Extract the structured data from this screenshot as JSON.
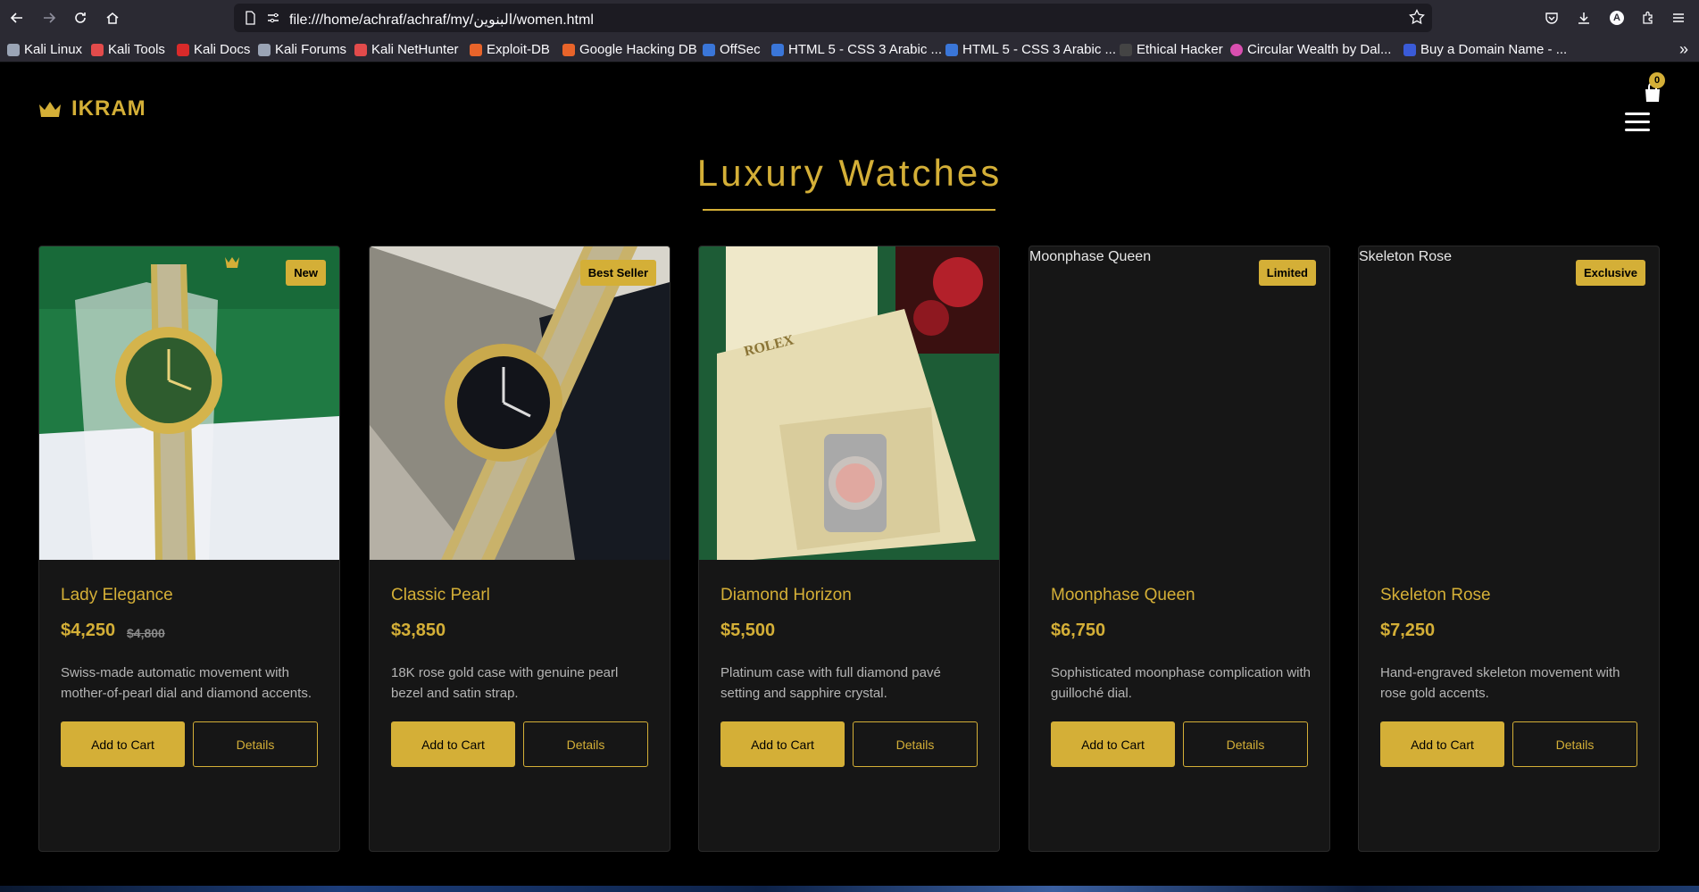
{
  "browser": {
    "url": "file:///home/achraf/achraf/my/البنوين/women.html",
    "avatar_letter": "A"
  },
  "bookmarks": [
    {
      "label": "Kali Linux",
      "icon": "kali-dragon-icon",
      "color": "#9aa4b5"
    },
    {
      "label": "Kali Tools",
      "icon": "kali-tools-icon",
      "color": "#e24b4b"
    },
    {
      "label": "Kali Docs",
      "icon": "kali-docs-icon",
      "color": "#d92a2a"
    },
    {
      "label": "Kali Forums",
      "icon": "kali-dragon-icon",
      "color": "#9aa4b5"
    },
    {
      "label": "Kali NetHunter",
      "icon": "nethunter-icon",
      "color": "#e24b4b"
    },
    {
      "label": "Exploit-DB",
      "icon": "exploit-db-icon",
      "color": "#e8642a"
    },
    {
      "label": "Google Hacking DB",
      "icon": "ghdb-icon",
      "color": "#e8642a"
    },
    {
      "label": "OffSec",
      "icon": "offsec-icon",
      "color": "#3a76d8"
    },
    {
      "label": "HTML 5 - CSS 3 Arabic ...",
      "icon": "html-course-icon",
      "color": "#3a76d8"
    },
    {
      "label": "HTML 5 - CSS 3 Arabic ...",
      "icon": "html-course-icon",
      "color": "#3a76d8"
    },
    {
      "label": "Ethical Hacker",
      "icon": "ethical-hacker-icon",
      "color": "#444444"
    },
    {
      "label": "Circular Wealth by Dal...",
      "icon": "circular-wealth-icon",
      "color": "#d94fb0"
    },
    {
      "label": "Buy a Domain Name - ...",
      "icon": "domain-icon",
      "color": "#3a5bd8"
    }
  ],
  "site": {
    "logo_text": "IKRAM",
    "cart_count": "0",
    "section_title": "Luxury Watches",
    "accent_color": "#d4af37"
  },
  "products": [
    {
      "name": "Lady Elegance",
      "price": "$4,250",
      "old_price": "$4,800",
      "badge": "New",
      "image_alt": "",
      "description": "Swiss-made automatic movement with mother-of-pearl dial and diamond accents.",
      "add_label": "Add to Cart",
      "details_label": "Details"
    },
    {
      "name": "Classic Pearl",
      "price": "$3,850",
      "old_price": "",
      "badge": "Best Seller",
      "image_alt": "",
      "description": "18K rose gold case with genuine pearl bezel and satin strap.",
      "add_label": "Add to Cart",
      "details_label": "Details"
    },
    {
      "name": "Diamond Horizon",
      "price": "$5,500",
      "old_price": "",
      "badge": "",
      "image_alt": "",
      "description": "Platinum case with full diamond pavé setting and sapphire crystal.",
      "add_label": "Add to Cart",
      "details_label": "Details"
    },
    {
      "name": "Moonphase Queen",
      "price": "$6,750",
      "old_price": "",
      "badge": "Limited",
      "image_alt": "Moonphase Queen",
      "description": "Sophisticated moonphase complication with guilloché dial.",
      "add_label": "Add to Cart",
      "details_label": "Details"
    },
    {
      "name": "Skeleton Rose",
      "price": "$7,250",
      "old_price": "",
      "badge": "Exclusive",
      "image_alt": "Skeleton Rose",
      "description": "Hand-engraved skeleton movement with rose gold accents.",
      "add_label": "Add to Cart",
      "details_label": "Details"
    }
  ]
}
